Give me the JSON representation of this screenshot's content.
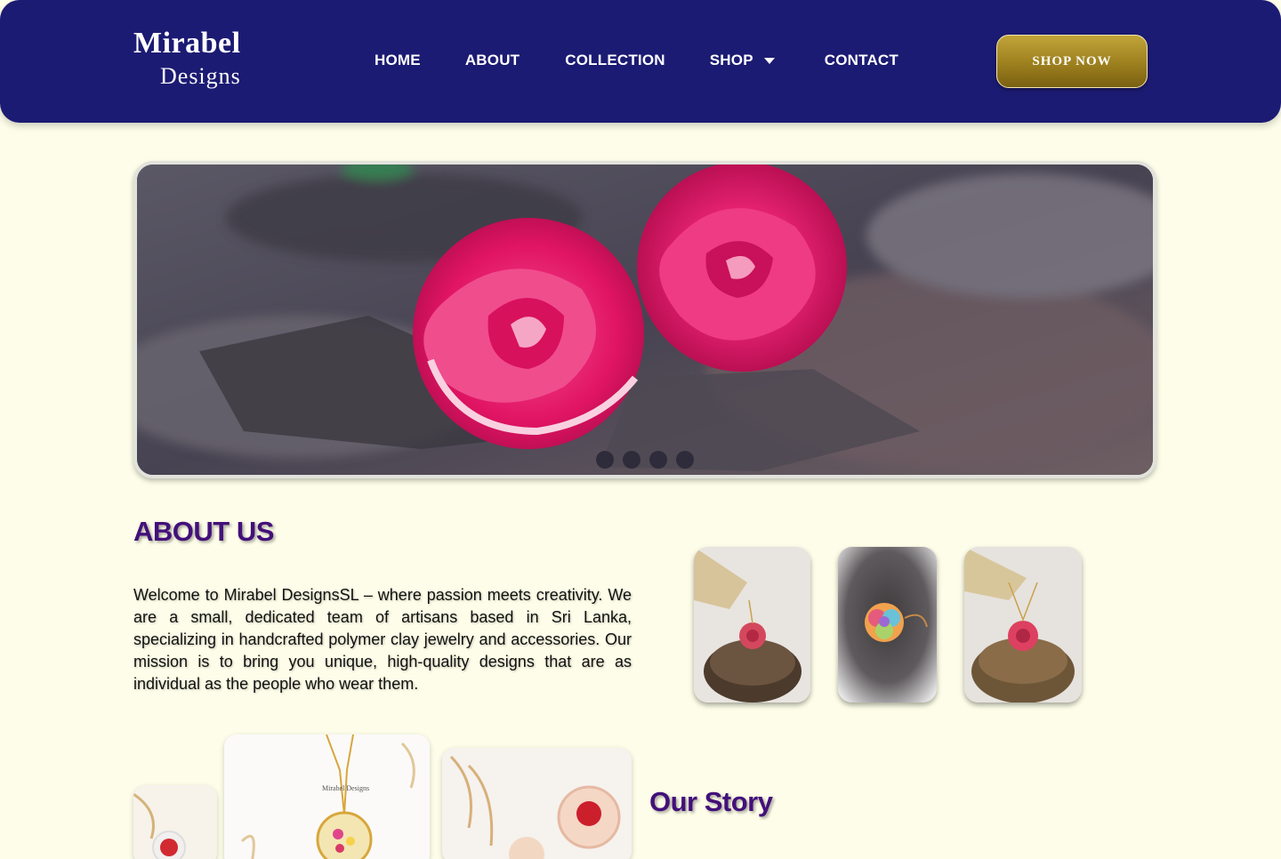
{
  "brand": {
    "name_main": "Mirabel",
    "name_sub": "Designs"
  },
  "nav": {
    "items": [
      {
        "label": "HOME"
      },
      {
        "label": "ABOUT"
      },
      {
        "label": "COLLECTION"
      },
      {
        "label": "SHOP",
        "has_dropdown": true
      },
      {
        "label": "CONTACT"
      }
    ],
    "cta_label": "SHOP NOW"
  },
  "hero": {
    "slide_count": 4,
    "active_slide": 1
  },
  "about": {
    "title": "ABOUT US",
    "text": "Welcome to Mirabel DesignsSL – where passion meets creativity. We are a small, dedicated team of artisans based in Sri Lanka, specializing in handcrafted polymer clay jewelry and accessories. Our mission is to bring you unique, high-quality designs that are as individual as the people who wear them."
  },
  "story": {
    "title": "Our Story"
  },
  "product_labels": {
    "tag_text": "Mirabel Designs"
  },
  "colors": {
    "header_bg": "#1c1b73",
    "page_bg": "#fdfde9",
    "heading": "#43107a",
    "cta_gold": "#9d801e"
  }
}
